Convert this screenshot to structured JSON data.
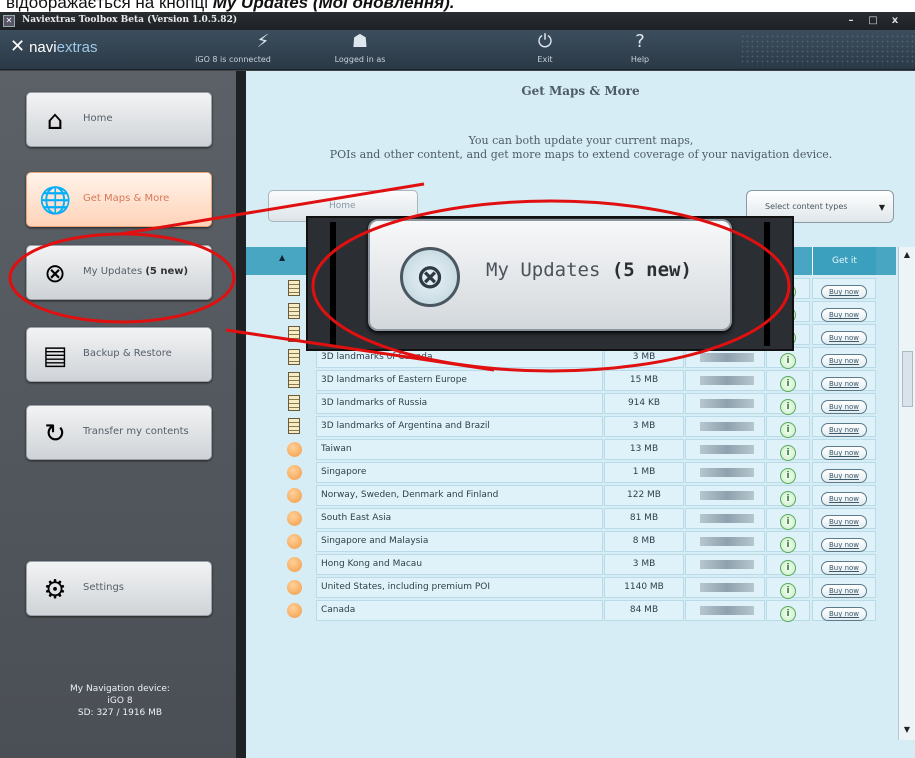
{
  "caption": {
    "text": "відображається на кнопці ",
    "emph": "My Updates (Мої оновлення)."
  },
  "titlebar": {
    "title": "Naviextras Toolbox Beta (Version 1.0.5.82)",
    "minimize": "–",
    "maximize": "□",
    "close": "x"
  },
  "toolbar": {
    "logo_navi": "navi",
    "logo_extras": "extras",
    "connection_status": "iGO 8 is connected",
    "login_status": "Logged in as",
    "exit_label": "Exit",
    "help_label": "Help"
  },
  "sidebar": {
    "items": [
      {
        "label": "Home",
        "icon": "home-icon",
        "glyph": "⌂"
      },
      {
        "label": "Get Maps & More",
        "icon": "globe-icon",
        "glyph": "🌐"
      },
      {
        "label": "My Updates",
        "badge": "(5 new)",
        "icon": "compass-icon",
        "glyph": "⊗"
      },
      {
        "label": "Backup & Restore",
        "icon": "backup-icon",
        "glyph": "▤"
      },
      {
        "label": "Transfer my contents",
        "icon": "transfer-icon",
        "glyph": "↻"
      },
      {
        "label": "Settings",
        "icon": "gear-icon",
        "glyph": "⚙"
      }
    ],
    "device": {
      "line1": "My Navigation device:",
      "line2": "iGO 8",
      "line3": "SD: 327 / 1916 MB"
    }
  },
  "main": {
    "title": "Get Maps & More",
    "subtitle_line1": "You can both update your current maps,",
    "subtitle_line2": "POIs and other content, and get more maps to extend coverage of your navigation device.",
    "tab_label": "Home",
    "select_label": "Select content types",
    "grid": {
      "sort_glyph": "▲",
      "get_it_header": "Get it",
      "buy_label": "Buy now",
      "info_glyph": "i",
      "rows": [
        {
          "name": "",
          "size": "",
          "type": "landmark"
        },
        {
          "name": "3D ...",
          "size": "",
          "type": "landmark"
        },
        {
          "name": "3D landmarks ...",
          "size": "",
          "type": "landmark"
        },
        {
          "name": "3D landmarks of Canada",
          "size": "3 MB",
          "type": "landmark"
        },
        {
          "name": "3D landmarks of Eastern Europe",
          "size": "15 MB",
          "type": "landmark"
        },
        {
          "name": "3D landmarks of Russia",
          "size": "914 KB",
          "type": "landmark"
        },
        {
          "name": "3D landmarks of Argentina and Brazil",
          "size": "3 MB",
          "type": "landmark"
        },
        {
          "name": "Taiwan",
          "size": "13 MB",
          "type": "map"
        },
        {
          "name": "Singapore",
          "size": "1 MB",
          "type": "map"
        },
        {
          "name": "Norway, Sweden, Denmark and Finland",
          "size": "122 MB",
          "type": "map"
        },
        {
          "name": "South East Asia",
          "size": "81 MB",
          "type": "map"
        },
        {
          "name": "Singapore and Malaysia",
          "size": "8 MB",
          "type": "map"
        },
        {
          "name": "Hong Kong and Macau",
          "size": "3 MB",
          "type": "map"
        },
        {
          "name": "United States, including premium POI",
          "size": "1140 MB",
          "type": "map"
        },
        {
          "name": "Canada",
          "size": "84 MB",
          "type": "map"
        }
      ]
    }
  },
  "zoom_callout": {
    "label": "My Updates",
    "badge": "(5 new)",
    "icon": "compass-icon",
    "glyph": "⊗"
  },
  "colors": {
    "highlight_red": "#e01010",
    "grid_header": "#49a6c2",
    "row_bg": "#dff2f9"
  }
}
